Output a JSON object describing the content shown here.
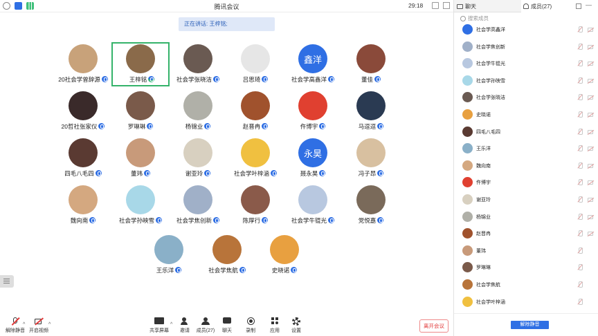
{
  "window": {
    "title": "腾讯会议",
    "timer": "29:18"
  },
  "speaking": {
    "text": "正在讲话: 王梓铭;"
  },
  "participants": [
    {
      "name": "20社会学曾辞源",
      "color": "#c8a27a",
      "avatar_text": ""
    },
    {
      "name": "王梓铭",
      "color": "#8a6a4a",
      "avatar_text": "",
      "selected": true
    },
    {
      "name": "社会学张晓洁",
      "color": "#6a5a52",
      "avatar_text": ""
    },
    {
      "name": "吕思琦",
      "color": "#e6e6e6",
      "avatar_text": ""
    },
    {
      "name": "社会学高鑫洋",
      "color": "#2f6fe4",
      "avatar_text": "鑫洋"
    },
    {
      "name": "董佳",
      "color": "#8a4a3a",
      "avatar_text": ""
    },
    {
      "name": "20哲社张家仪",
      "color": "#3a2a2a",
      "avatar_text": ""
    },
    {
      "name": "罗琳琳",
      "color": "#7a5a4a",
      "avatar_text": ""
    },
    {
      "name": "杨锦业",
      "color": "#b0b0a8",
      "avatar_text": ""
    },
    {
      "name": "赵晋冉",
      "color": "#a0522d",
      "avatar_text": ""
    },
    {
      "name": "仵博宇",
      "color": "#e04030",
      "avatar_text": ""
    },
    {
      "name": "马逗逗",
      "color": "#2a3a52",
      "avatar_text": ""
    },
    {
      "name": "四毛八毛四",
      "color": "#5a3a32",
      "avatar_text": ""
    },
    {
      "name": "董玮",
      "color": "#c89a7a",
      "avatar_text": ""
    },
    {
      "name": "谢亚玲",
      "color": "#d8d0c0",
      "avatar_text": ""
    },
    {
      "name": "社会学叶梓涵",
      "color": "#f0c040",
      "avatar_text": ""
    },
    {
      "name": "聂永昊",
      "color": "#2f6fe4",
      "avatar_text": "永昊"
    },
    {
      "name": "冯子昂",
      "color": "#d8c0a0",
      "avatar_text": ""
    },
    {
      "name": "魏向南",
      "color": "#d4a880",
      "avatar_text": ""
    },
    {
      "name": "社会学孙映雪",
      "color": "#a8d8e8",
      "avatar_text": ""
    },
    {
      "name": "社会学焦创新",
      "color": "#a0b0c8",
      "avatar_text": ""
    },
    {
      "name": "陈厚行",
      "color": "#8a5a4a",
      "avatar_text": ""
    },
    {
      "name": "社会学牛锟光",
      "color": "#b8c8e0",
      "avatar_text": ""
    },
    {
      "name": "党悦嘉",
      "color": "#7a6a5a",
      "avatar_text": ""
    },
    {
      "name": "王乐洋",
      "color": "#8ab0c8",
      "avatar_text": ""
    },
    {
      "name": "社会学焦航",
      "color": "#b8743a",
      "avatar_text": ""
    },
    {
      "name": "史晓诺",
      "color": "#e8a040",
      "avatar_text": ""
    }
  ],
  "toolbar": {
    "unmute": "解除静音",
    "video": "开启视频",
    "share": "共享屏幕",
    "invite": "邀请",
    "members": "成员(27)",
    "chat": "聊天",
    "record": "录制",
    "apps": "应用",
    "settings": "设置",
    "leave": "离开会议"
  },
  "panel": {
    "tab_chat": "聊天",
    "tab_members": "成员(27)",
    "search_placeholder": "搜索成员",
    "unmute_all": "解除静音",
    "members": [
      {
        "name": "社会学高鑫洋",
        "color": "#2f6fe4"
      },
      {
        "name": "社会学焦创新",
        "color": "#a0b0c8"
      },
      {
        "name": "社会学牛锟光",
        "color": "#b8c8e0"
      },
      {
        "name": "社会学孙映雪",
        "color": "#a8d8e8"
      },
      {
        "name": "社会学张晓洁",
        "color": "#6a5a52"
      },
      {
        "name": "史晓诺",
        "color": "#e8a040"
      },
      {
        "name": "四毛八毛四",
        "color": "#5a3a32"
      },
      {
        "name": "王乐洋",
        "color": "#8ab0c8"
      },
      {
        "name": "魏向南",
        "color": "#d4a880"
      },
      {
        "name": "仵博宇",
        "color": "#e04030"
      },
      {
        "name": "谢亚玲",
        "color": "#d8d0c0"
      },
      {
        "name": "杨锦业",
        "color": "#b0b0a8"
      },
      {
        "name": "赵晋冉",
        "color": "#a0522d"
      },
      {
        "name": "董玮",
        "color": "#c89a7a"
      },
      {
        "name": "罗琳琳",
        "color": "#7a5a4a"
      },
      {
        "name": "社会学焦航",
        "color": "#b8743a"
      },
      {
        "name": "社会学叶梓涵",
        "color": "#f0c040"
      }
    ]
  }
}
